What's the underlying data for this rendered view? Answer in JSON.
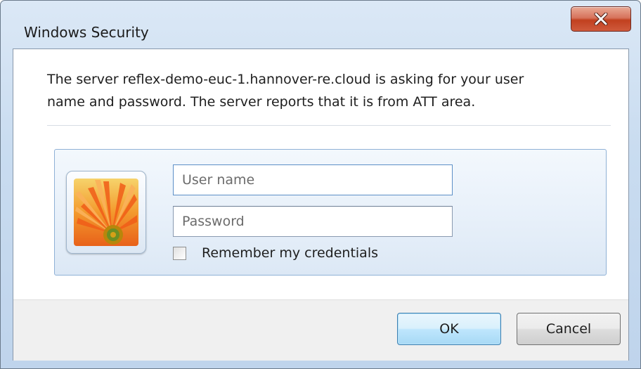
{
  "window": {
    "title": "Windows Security",
    "close_label": "X"
  },
  "message": {
    "text": "The server reflex-demo-euc-1.hannover-re.cloud is asking for your user\nname and password. The server reports that it is from ATT area."
  },
  "credentials": {
    "username_placeholder": "User name",
    "username_value": "",
    "password_placeholder": "Password",
    "password_value": "",
    "remember_label": "Remember my credentials",
    "remember_checked": false,
    "tile_icon": "flower-icon"
  },
  "buttons": {
    "ok_label": "OK",
    "cancel_label": "Cancel"
  },
  "colors": {
    "close_button": "#c1401f",
    "ok_button_border": "#3c7fb1",
    "panel_border": "#8fb1d6"
  }
}
